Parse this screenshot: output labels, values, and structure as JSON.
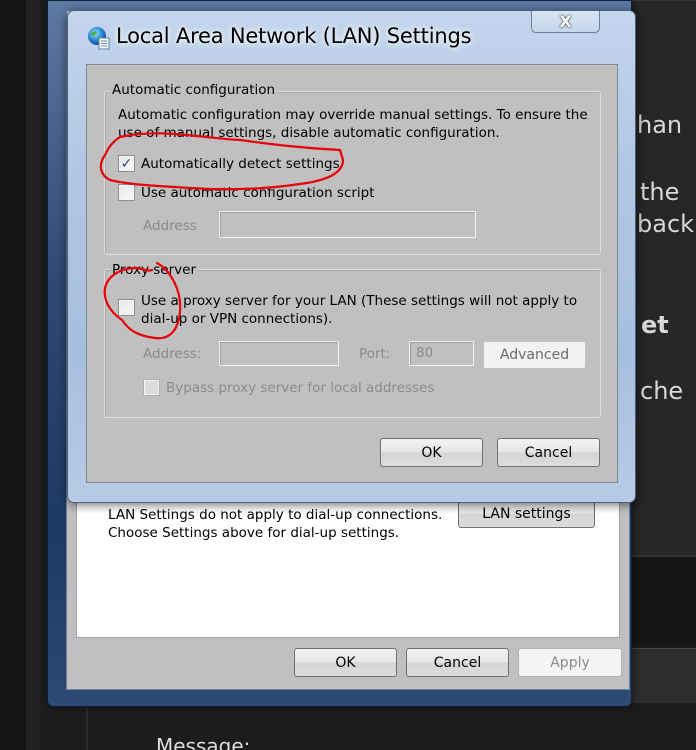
{
  "background_page": {
    "text_fragments": [
      "han",
      "the",
      "back",
      "et",
      "che"
    ],
    "message_label": "Message:"
  },
  "outer_window": {
    "obscured_title_text": "Local Area Network (LAN) Settings",
    "lan_info_line1": "LAN Settings do not apply to dial-up connections.",
    "lan_info_line2": "Choose Settings above for dial-up settings.",
    "lan_settings_button": "LAN settings",
    "ok_button": "OK",
    "cancel_button": "Cancel",
    "apply_button": "Apply"
  },
  "lan_dialog": {
    "title": "Local Area Network (LAN) Settings",
    "title_icon": "network-globe-icon",
    "close_button": "X",
    "automatic_configuration": {
      "legend": "Automatic configuration",
      "description_line1": "Automatic configuration may override manual settings.  To ensure the",
      "description_line2": "use of manual settings, disable automatic configuration.",
      "auto_detect": {
        "label": "Automatically detect settings",
        "checked": true,
        "check_glyph": "✓"
      },
      "use_script": {
        "label": "Use automatic configuration script",
        "checked": false
      },
      "address_label": "Address",
      "address_value": ""
    },
    "proxy_server": {
      "legend": "Proxy server",
      "use_proxy": {
        "label_line1": "Use a proxy server for your LAN (These settings will not apply to",
        "label_line2": "dial-up or VPN connections).",
        "checked": false
      },
      "address_label": "Address:",
      "address_value": "",
      "port_label": "Port:",
      "port_value": "80",
      "advanced_button": "Advanced",
      "bypass": {
        "label": "Bypass proxy server for local addresses",
        "checked": false
      }
    },
    "ok_button": "OK",
    "cancel_button": "Cancel"
  },
  "annotations": {
    "color": "#e8000b",
    "circled_items": [
      "Automatically detect settings",
      "Use a proxy server checkbox"
    ]
  }
}
